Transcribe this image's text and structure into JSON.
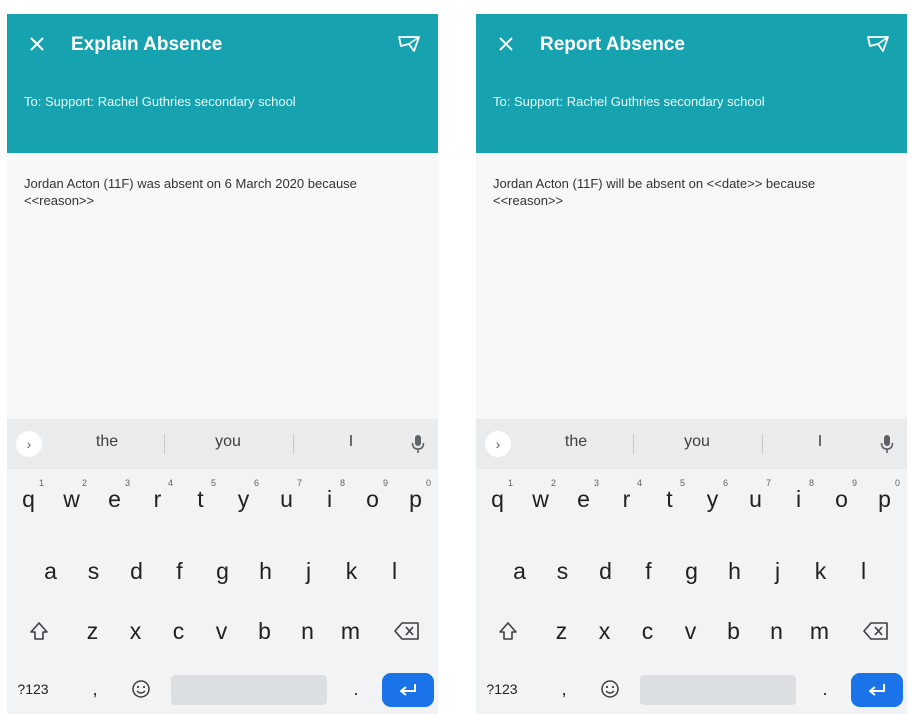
{
  "screens": [
    {
      "title": "Explain Absence",
      "to": "To: Support: Rachel Guthries secondary school",
      "message": "Jordan Acton (11F) was absent on 6 March 2020 because <<reason>>"
    },
    {
      "title": "Report Absence",
      "to": "To: Support: Rachel Guthries secondary school",
      "message": "Jordan Acton (11F) will be absent on <<date>> because <<reason>>"
    }
  ],
  "keyboard": {
    "suggestions": [
      "the",
      "you",
      "I"
    ],
    "row1": [
      {
        "key": "q",
        "hint": "1"
      },
      {
        "key": "w",
        "hint": "2"
      },
      {
        "key": "e",
        "hint": "3"
      },
      {
        "key": "r",
        "hint": "4"
      },
      {
        "key": "t",
        "hint": "5"
      },
      {
        "key": "y",
        "hint": "6"
      },
      {
        "key": "u",
        "hint": "7"
      },
      {
        "key": "i",
        "hint": "8"
      },
      {
        "key": "o",
        "hint": "9"
      },
      {
        "key": "p",
        "hint": "0"
      }
    ],
    "row2": [
      "a",
      "s",
      "d",
      "f",
      "g",
      "h",
      "j",
      "k",
      "l"
    ],
    "row3": [
      "z",
      "x",
      "c",
      "v",
      "b",
      "n",
      "m"
    ],
    "symbols_label": "?123",
    "comma": ",",
    "period": "."
  },
  "colors": {
    "header": "#17a2b0",
    "enter_key": "#1a73e8"
  },
  "icons": [
    "close-icon",
    "send-icon",
    "expand-icon",
    "mic-icon",
    "shift-icon",
    "backspace-icon",
    "emoji-icon",
    "enter-icon"
  ]
}
